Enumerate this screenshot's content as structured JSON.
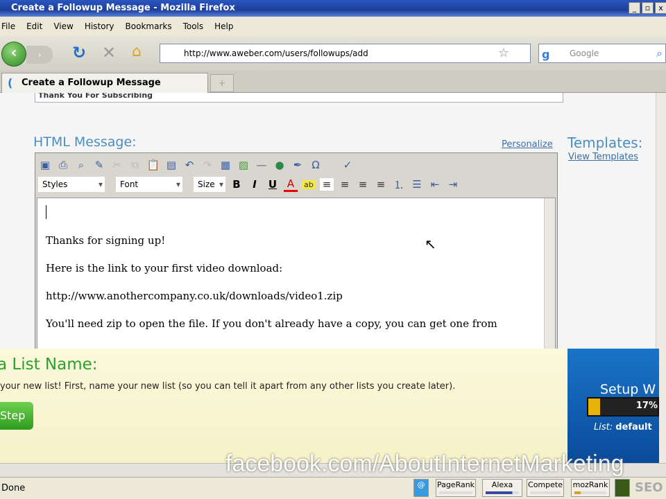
{
  "window": {
    "title": "Create a Followup Message - Mozilla Firefox",
    "controls": [
      "_",
      "▫",
      "x"
    ]
  },
  "menu": [
    "File",
    "Edit",
    "View",
    "History",
    "Bookmarks",
    "Tools",
    "Help"
  ],
  "nav": {
    "url": "http://www.aweber.com/users/followups/add",
    "search_placeholder": "Google"
  },
  "tabs": [
    {
      "label": "Create a Followup Message"
    }
  ],
  "page": {
    "subject_value": "Thank You For Subscribing",
    "html_message_label": "HTML Message:",
    "personalize": "Personalize",
    "templates_label": "Templates:",
    "view_templates": "View Templates",
    "editor": {
      "styles": "Styles",
      "font": "Font",
      "size": "Size",
      "bold": "B",
      "italic": "I",
      "underline": "U",
      "lines": [
        "Thanks for signing up!",
        "Here is the link to your first video download:",
        "http://www.anothercompany.co.uk/downloads/video1.zip",
        "You'll need zip to open the file. If you don't already have a copy, you can get one from"
      ]
    }
  },
  "overlay": {
    "title": "a List Name:",
    "description": "your new list! First, name your new list (so you can tell it apart from any other lists you create later).",
    "button": "Step",
    "wizard_title": "Setup W",
    "progress_percent": 17,
    "progress_label": "17%",
    "list_label": "List:",
    "list_value": "default"
  },
  "watermark": "facebook.com/AboutInternetMarketing",
  "status": {
    "text": "Done",
    "items": [
      "PageRank",
      "Alexa",
      "Compete",
      "mozRank"
    ],
    "seo": "SEO"
  }
}
